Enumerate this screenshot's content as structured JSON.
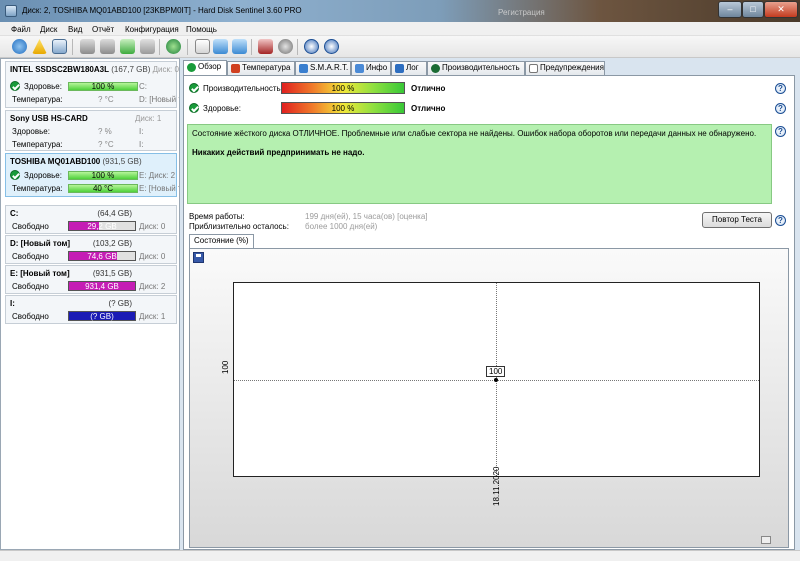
{
  "window": {
    "title": "Диск: 2, TOSHIBA MQ01ABD100 [23KBPM0IT]  -  Hard Disk Sentinel 3.60 PRO",
    "registration_text": "Регистрация",
    "min_label": "–",
    "max_label": "□",
    "close_label": "✕"
  },
  "menu": [
    "Файл",
    "Диск",
    "Вид",
    "Отчёт",
    "Конфигурация",
    "Помощь"
  ],
  "disks": [
    {
      "name": "INTEL SSDSC2BW180A3L",
      "size": "(167,7 GB)",
      "disk_no": "Диск: 0",
      "health_label": "Здоровье:",
      "health": "100 %",
      "health_pct": 100,
      "health_right": "C:",
      "temp_label": "Температура:",
      "temp": "? °C",
      "temp_right": "D: [Новый то"
    },
    {
      "name": "Sony    USB    HS-CARD",
      "size": "",
      "disk_no": "Диск: 1",
      "health_label": "Здоровье:",
      "health": "? %",
      "health_right": "I:",
      "temp_label": "Температура:",
      "temp": "? °C",
      "temp_right": "I:"
    },
    {
      "name": "TOSHIBA MQ01ABD100",
      "size": "(931,5 GB)",
      "disk_no": "Диск: 2",
      "health_label": "Здоровье:",
      "health": "100 %",
      "health_pct": 100,
      "health_right": "E:",
      "temp_label": "Температура:",
      "temp": "40 °C",
      "temp_right": "E: [Новый то"
    }
  ],
  "volumes": [
    {
      "name": "C:",
      "size": "(64,4 GB)",
      "free_label": "Свободно",
      "free": "29,2 GB",
      "free_pct": 45,
      "fill_color": "#c51db5",
      "disk": "Диск: 0"
    },
    {
      "name": "D: [Новый том]",
      "size": "(103,2 GB)",
      "free_label": "Свободно",
      "free": "74,6 GB",
      "free_pct": 72,
      "fill_color": "#c51db5",
      "disk": "Диск: 0"
    },
    {
      "name": "E: [Новый том]",
      "size": "(931,5 GB)",
      "free_label": "Свободно",
      "free": "931,4 GB",
      "free_pct": 100,
      "fill_color": "#c51db5",
      "disk": "Диск: 2"
    },
    {
      "name": "I:",
      "size": "(? GB)",
      "free_label": "Свободно",
      "free": "(? GB)",
      "free_pct": 0,
      "fill_color": "#1b1bb5",
      "disk": "Диск: 1"
    }
  ],
  "tabs": [
    "Обзор",
    "Температура",
    "S.M.A.R.T.",
    "Инфо",
    "Лог",
    "Производительность",
    "Предупреждения"
  ],
  "overview": {
    "performance_label": "Производительность:",
    "performance": "100 %",
    "performance_rating": "Отлично",
    "health_label": "Здоровье:",
    "health": "100 %",
    "health_rating": "Отлично",
    "status_text": "Состояние жёсткого диска ОТЛИЧНОЕ. Проблемные или слабые сектора не найдены. Ошибок набора оборотов или передачи данных не обнаружено.",
    "action_text": "Никаких действий предпринимать не надо.",
    "uptime_label": "Время работы:",
    "uptime_value": "199 дня(ей), 15 часа(ов) [оценка]",
    "remaining_label": "Приблизительно осталось:",
    "remaining_value": "более 1000 дня(ей)",
    "retest_label": "Повтор Теста",
    "help_label": "?"
  },
  "chart_tab_label": "Состояние (%)",
  "chart_data": {
    "type": "line",
    "x": [
      "18.11.2020"
    ],
    "series": [
      {
        "values": [
          100
        ]
      }
    ],
    "ylabel_tick": "100",
    "xlabel_tick": "18.11.2020",
    "point_label": "100",
    "grid": true
  }
}
